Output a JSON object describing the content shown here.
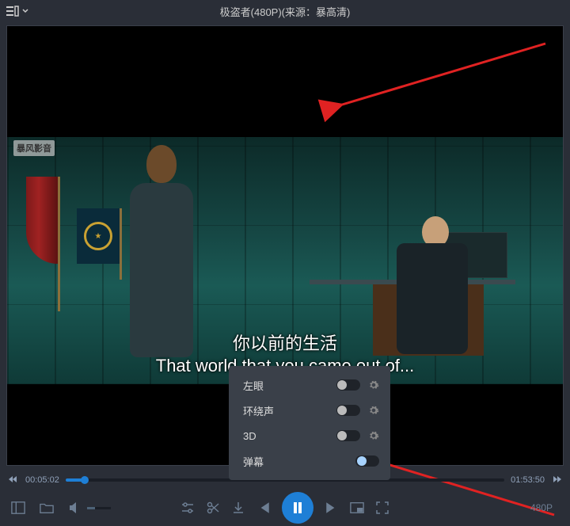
{
  "topbar": {
    "title": "极盗者(480P)(来源：暴高清)"
  },
  "watermark": "暴风影音",
  "subtitle": {
    "cn": "你以前的生活",
    "en": "That world that you came out of..."
  },
  "popup": {
    "items": [
      {
        "label": "左眼",
        "has_gear": true
      },
      {
        "label": "环绕声",
        "has_gear": true
      },
      {
        "label": "3D",
        "has_gear": true
      },
      {
        "label": "弹幕",
        "has_gear": false,
        "on": true
      }
    ]
  },
  "progress": {
    "current": "00:05:02",
    "total": "01:53:50",
    "percent": 4.4
  },
  "quality": "480P",
  "icons": {
    "playlist": "playlist-icon",
    "open": "folder-icon",
    "volume": "volume-icon",
    "tune": "tune-icon",
    "cut": "scissors-icon",
    "download": "download-icon",
    "prev_track": "prev-track-icon",
    "pause": "pause-icon",
    "next_track": "next-track-icon",
    "pip": "pip-icon",
    "fullscreen": "fullscreen-icon"
  }
}
